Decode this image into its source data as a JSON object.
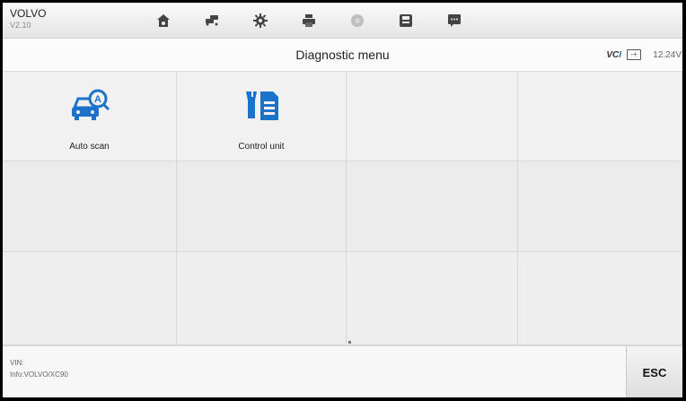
{
  "header": {
    "make": "VOLVO",
    "version": "V2.10",
    "toolbar": [
      {
        "name": "home-icon"
      },
      {
        "name": "vehicle-swap-icon"
      },
      {
        "name": "settings-icon"
      },
      {
        "name": "print-icon"
      },
      {
        "name": "help-icon"
      },
      {
        "name": "save-icon"
      },
      {
        "name": "message-icon"
      }
    ]
  },
  "titlebar": {
    "title": "Diagnostic menu",
    "vci_label": "VCI",
    "battery_icon": "battery-icon",
    "voltage": "12.24V"
  },
  "menu": {
    "items": [
      {
        "label": "Auto scan",
        "icon": "auto-scan-icon"
      },
      {
        "label": "Control unit",
        "icon": "control-unit-icon"
      }
    ]
  },
  "footer": {
    "vin_label": "VIN:",
    "info": "Info:VOLVO/XC90",
    "esc_label": "ESC"
  },
  "colors": {
    "accent": "#1a73c8",
    "toolbar_icon": "#444444"
  }
}
